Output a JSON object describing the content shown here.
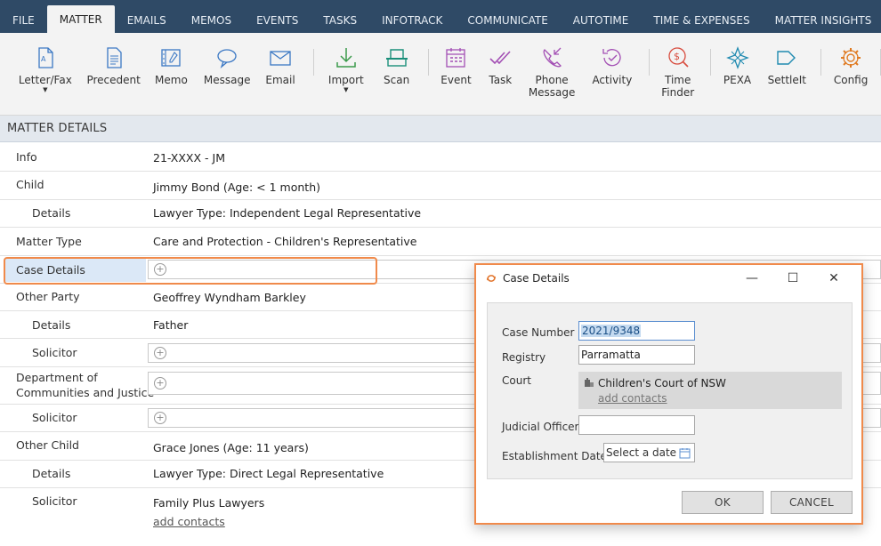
{
  "tabs": [
    "FILE",
    "MATTER",
    "EMAILS",
    "MEMOS",
    "EVENTS",
    "TASKS",
    "INFOTRACK",
    "COMMUNICATE",
    "AUTOTIME",
    "TIME & EXPENSES",
    "MATTER INSIGHTS"
  ],
  "active_tab": "MATTER",
  "ribbon": {
    "letter": "Letter/Fax",
    "precedent": "Precedent",
    "memo": "Memo",
    "message": "Message",
    "email": "Email",
    "import": "Import",
    "scan": "Scan",
    "event": "Event",
    "task": "Task",
    "phone_line1": "Phone",
    "phone_line2": "Message",
    "activity": "Activity",
    "time_line1": "Time",
    "time_line2": "Finder",
    "pexa": "PEXA",
    "settleit": "SettleIt",
    "config": "Config"
  },
  "section_title": "MATTER DETAILS",
  "rows": {
    "info_label": "Info",
    "info_value": "21-XXXX - JM",
    "child_label": "Child",
    "child_value": "Jimmy Bond (Age: < 1 month)",
    "child_details_label": "Details",
    "child_details_value": "Lawyer Type: Independent Legal Representative",
    "matter_type_label": "Matter Type",
    "matter_type_value": "Care and Protection - Children's Representative",
    "case_details_label": "Case Details",
    "other_party_label": "Other Party",
    "other_party_value": "Geoffrey Wyndham Barkley",
    "other_party_details_label": "Details",
    "other_party_details_value": "Father",
    "other_party_solicitor_label": "Solicitor",
    "dept_label_line1": "Department of",
    "dept_label_line2": "Communities and Justice",
    "dept_solicitor_label": "Solicitor",
    "other_child_label": "Other Child",
    "other_child_value": "Grace Jones (Age: 11 years)",
    "other_child_details_label": "Details",
    "other_child_details_value": "Lawyer Type: Direct Legal Representative",
    "other_child_solicitor_label": "Solicitor",
    "other_child_solicitor_value": "Family Plus Lawyers",
    "add_contacts": "add contacts"
  },
  "dialog": {
    "title": "Case Details",
    "case_number_label": "Case Number",
    "case_number_value": "2021/9348",
    "registry_label": "Registry",
    "registry_value": "Parramatta",
    "court_label": "Court",
    "court_value": "Children's Court of NSW",
    "add_contacts": "add contacts",
    "judicial_officer_label": "Judicial Officer",
    "judicial_officer_value": "",
    "establishment_date_label": "Establishment Date",
    "date_placeholder": "Select a date",
    "ok": "OK",
    "cancel": "CANCEL"
  },
  "colors": {
    "tab_bar": "#2f4a66",
    "highlight": "#f08a4b",
    "ribbon_bg": "#f3f3f3"
  }
}
